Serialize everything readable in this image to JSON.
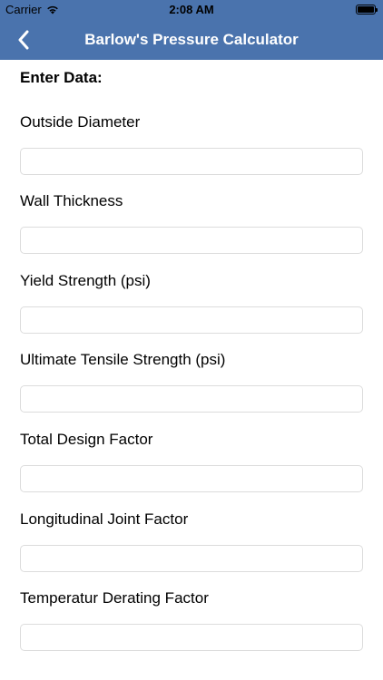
{
  "status_bar": {
    "carrier": "Carrier",
    "time": "2:08 AM"
  },
  "nav": {
    "title": "Barlow's Pressure Calculator",
    "back_icon": "chevron-left-icon"
  },
  "form": {
    "heading": "Enter Data:",
    "fields": [
      {
        "label": "Outside Diameter",
        "value": "",
        "placeholder": ""
      },
      {
        "label": "Wall Thickness",
        "value": "",
        "placeholder": ""
      },
      {
        "label": "Yield Strength (psi)",
        "value": "",
        "placeholder": ""
      },
      {
        "label": "Ultimate Tensile Strength (psi)",
        "value": "",
        "placeholder": ""
      },
      {
        "label": "Total Design Factor",
        "value": "",
        "placeholder": ""
      },
      {
        "label": "Longitudinal Joint Factor",
        "value": "",
        "placeholder": ""
      },
      {
        "label": "Temperatur Derating Factor",
        "value": "",
        "placeholder": ""
      }
    ]
  },
  "colors": {
    "nav_background": "#4a73ad",
    "nav_text": "#ffffff"
  }
}
